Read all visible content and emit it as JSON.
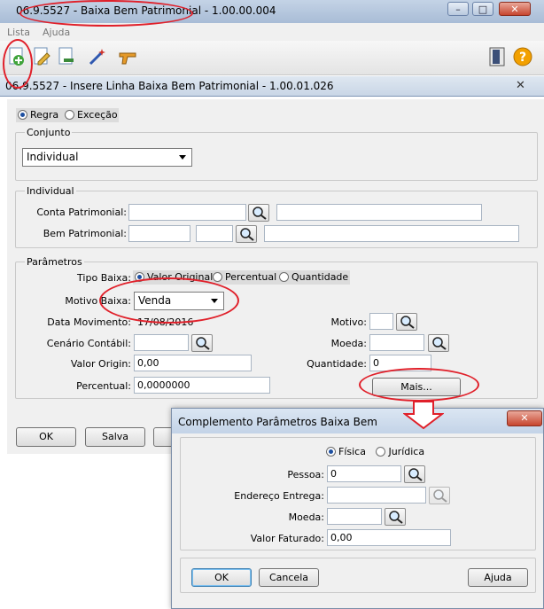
{
  "main_window": {
    "title": "06.9.5527 - Baixa Bem Patrimonial - 1.00.00.004"
  },
  "menu": {
    "items": [
      {
        "label": "Lista"
      },
      {
        "label": "Ajuda"
      }
    ]
  },
  "subwindow": {
    "title": "06.9.5527 - Insere Linha Baixa Bem Patrimonial - 1.00.01.026"
  },
  "mode": {
    "options": [
      {
        "label": "Regra",
        "selected": true
      },
      {
        "label": "Exceção",
        "selected": false
      }
    ]
  },
  "conjunto": {
    "legend": "Conjunto",
    "selected": "Individual"
  },
  "individual": {
    "legend": "Individual",
    "conta_label": "Conta Patrimonial:",
    "bem_label": "Bem Patrimonial:"
  },
  "parametros": {
    "legend": "Parâmetros",
    "tipo_label": "Tipo Baixa:",
    "tipo_options": [
      {
        "label": "Valor Original",
        "selected": true
      },
      {
        "label": "Percentual",
        "selected": false
      },
      {
        "label": "Quantidade",
        "selected": false
      }
    ],
    "motivo_baixa_label": "Motivo Baixa:",
    "motivo_baixa_value": "Venda",
    "data_label": "Data Movimento:",
    "data_value": "17/08/2016",
    "cenario_label": "Cenário Contábil:",
    "valor_label": "Valor Origin:",
    "valor_value": "0,00",
    "percentual_label": "Percentual:",
    "percentual_value": "0,0000000",
    "motivo_label": "Motivo:",
    "moeda_label": "Moeda:",
    "quantidade_label": "Quantidade:",
    "quantidade_value": "0",
    "mais_label": "Mais..."
  },
  "buttons": {
    "ok": "OK",
    "salva": "Salva"
  },
  "dialog": {
    "title": "Complemento Parâmetros Baixa Bem",
    "pessoa_options": [
      {
        "label": "Física",
        "selected": true
      },
      {
        "label": "Jurídica",
        "selected": false
      }
    ],
    "pessoa_label": "Pessoa:",
    "pessoa_value": "0",
    "endereco_label": "Endereço Entrega:",
    "moeda_label": "Moeda:",
    "valor_label": "Valor Faturado:",
    "valor_value": "0,00",
    "ok": "OK",
    "cancela": "Cancela",
    "ajuda": "Ajuda"
  },
  "colors": {
    "annotation": "#e0202a",
    "titlebar": "#b4c6de"
  }
}
